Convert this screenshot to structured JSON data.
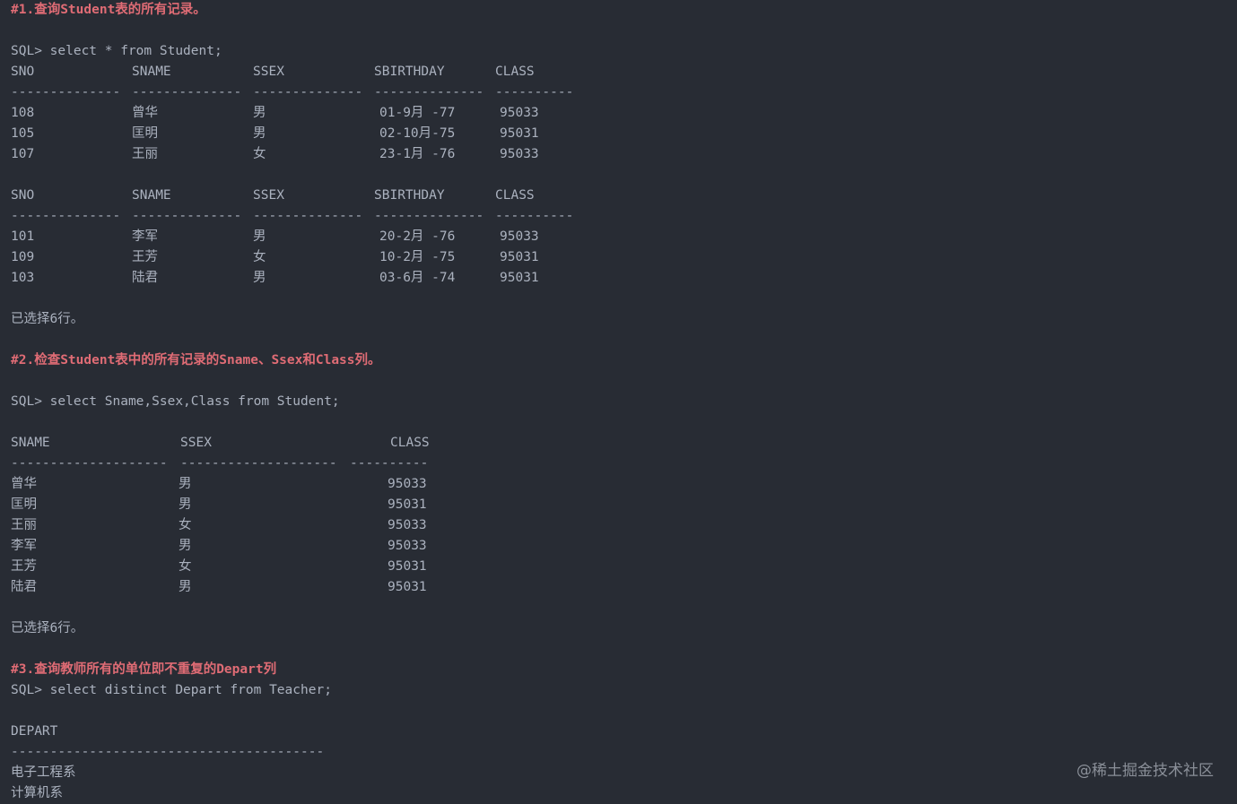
{
  "q1": {
    "comment": "#1.查询Student表的所有记录。",
    "prompt": "SQL> select * from Student;",
    "headers": [
      "SNO",
      "SNAME",
      "SSEX",
      "SBIRTHDAY",
      "CLASS"
    ],
    "dashes": [
      "--------------",
      "--------------",
      "--------------",
      "--------------",
      "----------"
    ],
    "block1": [
      [
        "108",
        "曾华",
        "男",
        "01-9月 -77",
        "95033"
      ],
      [
        "105",
        "匡明",
        "男",
        "02-10月-75",
        "95031"
      ],
      [
        "107",
        "王丽",
        "女",
        "23-1月 -76",
        "95033"
      ]
    ],
    "block2": [
      [
        "101",
        "李军",
        "男",
        "20-2月 -76",
        "95033"
      ],
      [
        "109",
        "王芳",
        "女",
        "10-2月 -75",
        "95031"
      ],
      [
        "103",
        "陆君",
        "男",
        "03-6月 -74",
        "95031"
      ]
    ],
    "result": "已选择6行。"
  },
  "q2": {
    "comment": "#2.检查Student表中的所有记录的Sname、Ssex和Class列。",
    "prompt": "SQL> select Sname,Ssex,Class from Student;",
    "headers": [
      "SNAME",
      "SSEX",
      "CLASS"
    ],
    "dashes": [
      "--------------------",
      "--------------------",
      "----------"
    ],
    "rows": [
      [
        "曾华",
        "男",
        "95033"
      ],
      [
        "匡明",
        "男",
        "95031"
      ],
      [
        "王丽",
        "女",
        "95033"
      ],
      [
        "李军",
        "男",
        "95033"
      ],
      [
        "王芳",
        "女",
        "95031"
      ],
      [
        "陆君",
        "男",
        "95031"
      ]
    ],
    "result": "已选择6行。"
  },
  "q3": {
    "comment": "#3.查询教师所有的单位即不重复的Depart列",
    "prompt": "SQL> select distinct Depart from Teacher;",
    "header": "DEPART",
    "dashes": "----------------------------------------",
    "rows": [
      "电子工程系",
      "计算机系"
    ]
  },
  "watermark": "@稀土掘金技术社区"
}
